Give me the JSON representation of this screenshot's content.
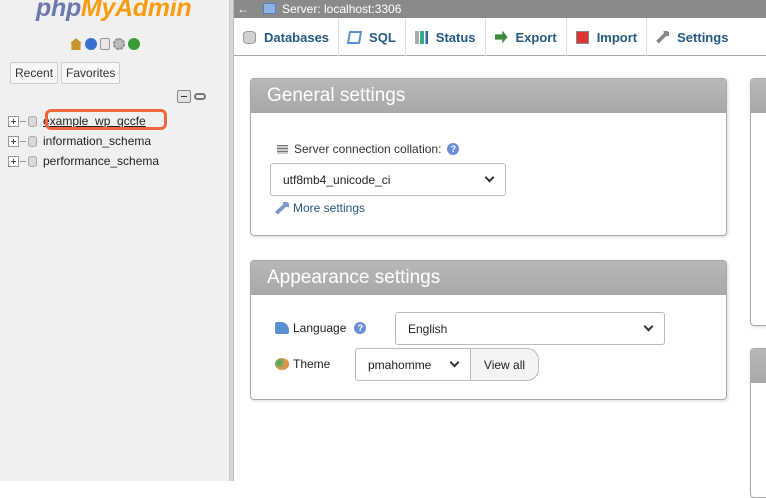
{
  "sidebar": {
    "logo_php": "php",
    "logo_admin": "MyAdmin",
    "quick_icons": [
      "home-icon",
      "logout-icon",
      "docs-icon",
      "sql-docs-icon",
      "settings-icon",
      "reload-icon"
    ],
    "recent_label": "Recent",
    "favorites_label": "Favorites",
    "databases": [
      {
        "name": "example_wp_qccfe"
      },
      {
        "name": "information_schema"
      },
      {
        "name": "performance_schema"
      }
    ]
  },
  "topbar": {
    "back": "←",
    "server_label": "Server: localhost:3306"
  },
  "menu": {
    "tabs": [
      {
        "label": "Databases",
        "icon": "database-icon"
      },
      {
        "label": "SQL",
        "icon": "sql-icon"
      },
      {
        "label": "Status",
        "icon": "status-icon"
      },
      {
        "label": "Export",
        "icon": "export-icon"
      },
      {
        "label": "Import",
        "icon": "import-icon"
      },
      {
        "label": "Settings",
        "icon": "settings-icon"
      }
    ]
  },
  "general": {
    "title": "General settings",
    "collation_label": "Server connection collation:",
    "collation_value": "utf8mb4_unicode_ci",
    "more_settings": "More settings"
  },
  "appearance": {
    "title": "Appearance settings",
    "language_label": "Language",
    "language_value": "English",
    "theme_label": "Theme",
    "theme_value": "pmahomme",
    "view_all": "View all"
  },
  "colors": {
    "accent_link": "#235a81",
    "highlight": "#f0673d",
    "panel_header": "#b0b0b0",
    "topbar": "#8a8a8a"
  }
}
